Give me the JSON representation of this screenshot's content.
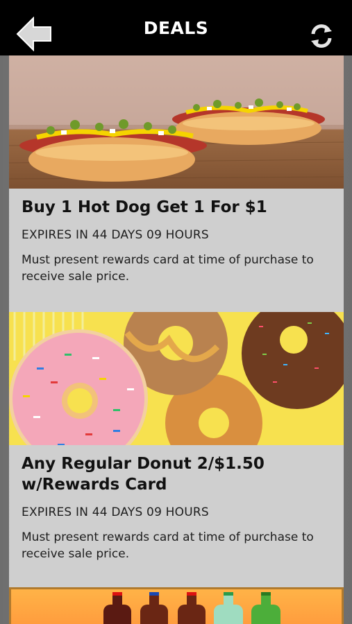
{
  "header": {
    "title": "DEALS",
    "back_icon": "back-arrow-icon",
    "refresh_icon": "refresh-icon"
  },
  "deals": [
    {
      "title": "Buy 1 Hot Dog Get 1 For $1",
      "expires": "EXPIRES IN 44 DAYS 09 HOURS",
      "description": "Must present rewards card at time of purchase to receive sale price."
    },
    {
      "title": "Any Regular Donut 2/$1.50 w/Rewards Card",
      "expires": "EXPIRES IN 44 DAYS 09 HOURS",
      "description": "Must present rewards card at time of purchase to receive sale price."
    }
  ],
  "colors": {
    "header_bg": "#000000",
    "card_bg": "#cfcfcf"
  }
}
